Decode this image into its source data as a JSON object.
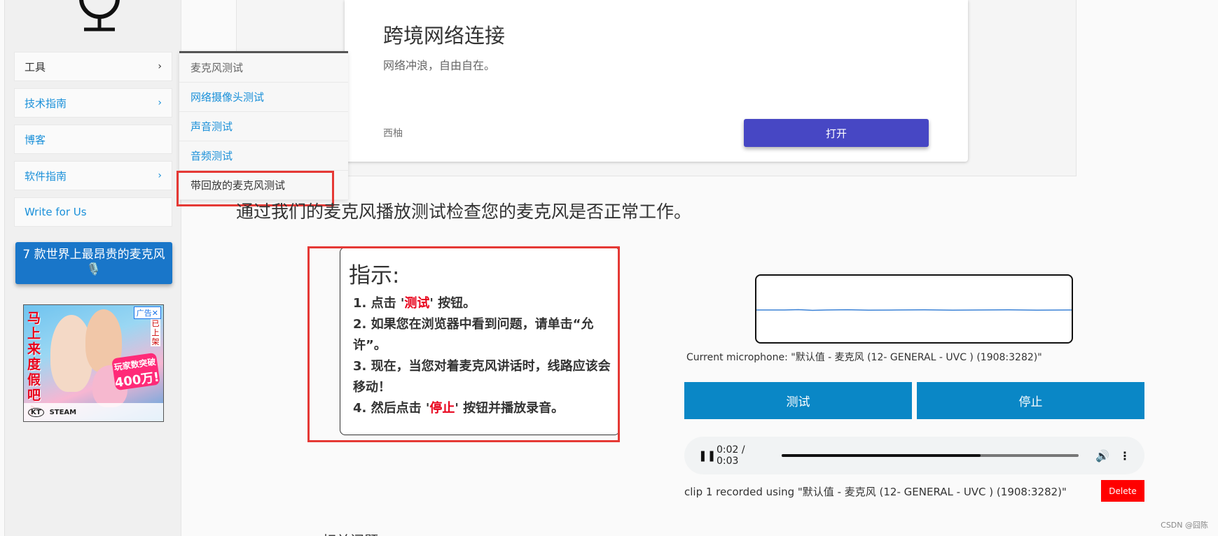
{
  "sidebar": {
    "items": [
      {
        "label": "工具",
        "chevron": "›"
      },
      {
        "label": "技术指南",
        "chevron": "›"
      },
      {
        "label": "博客",
        "chevron": ""
      },
      {
        "label": "软件指南",
        "chevron": "›"
      },
      {
        "label": "Write for Us",
        "chevron": ""
      }
    ],
    "promo_button": "7 款世界上最昂贵的麦克风🎙️"
  },
  "ad": {
    "badge": "广告✕",
    "tag": "已上架",
    "left_text": "马上来度假吧♪",
    "burst_line1": "玩家数突破",
    "burst_line2": "400万!",
    "footer_logo1": "KT",
    "footer_logo2": "STEAM"
  },
  "dropdown": {
    "items": [
      "麦克风测试",
      "网络摄像头测试",
      "声音测试",
      "音频测试",
      "带回放的麦克风测试"
    ]
  },
  "top_card": {
    "title": "跨境网络连接",
    "subtitle": "网络冲浪，自由自在。",
    "brand": "西柚",
    "button": "打开"
  },
  "headline": "通过我们的麦克风播放测试检查您的麦克风是否正常工作。",
  "instructions": {
    "title": "指示:",
    "step1_a": "1. 点击 '",
    "step1_hl": "测试",
    "step1_b": "' 按钮。",
    "step2": "2. 如果您在浏览器中看到问题，请单击“允许”。",
    "step3": "3. 现在，当您对着麦克风讲话时，线路应该会移动！",
    "step4_a": "4.  然后点击 '",
    "step4_hl": "停止",
    "step4_b": "' 按钮并播放录音。"
  },
  "recorder": {
    "current_mic": "Current microphone: \"默认值 - 麦克风 (12- GENERAL - UVC ) (1908:3282)\"",
    "test_button": "测试",
    "stop_button": "停止",
    "player_time": "0:02 / 0:03",
    "progress": 0.67,
    "clip_line": "clip 1 recorded using \"默认值 - 麦克风 (12- GENERAL - UVC ) (1908:3282)\"",
    "delete_button": "Delete"
  },
  "cut_text": "相关问题",
  "watermark": "CSDN @囧陈",
  "colors": {
    "link": "#1a90d9",
    "primary_button": "#0a87c6",
    "card_button": "#4747c4",
    "delete": "#ff0000",
    "highlight": "#e8001a",
    "annotation_box": "#e53935"
  }
}
